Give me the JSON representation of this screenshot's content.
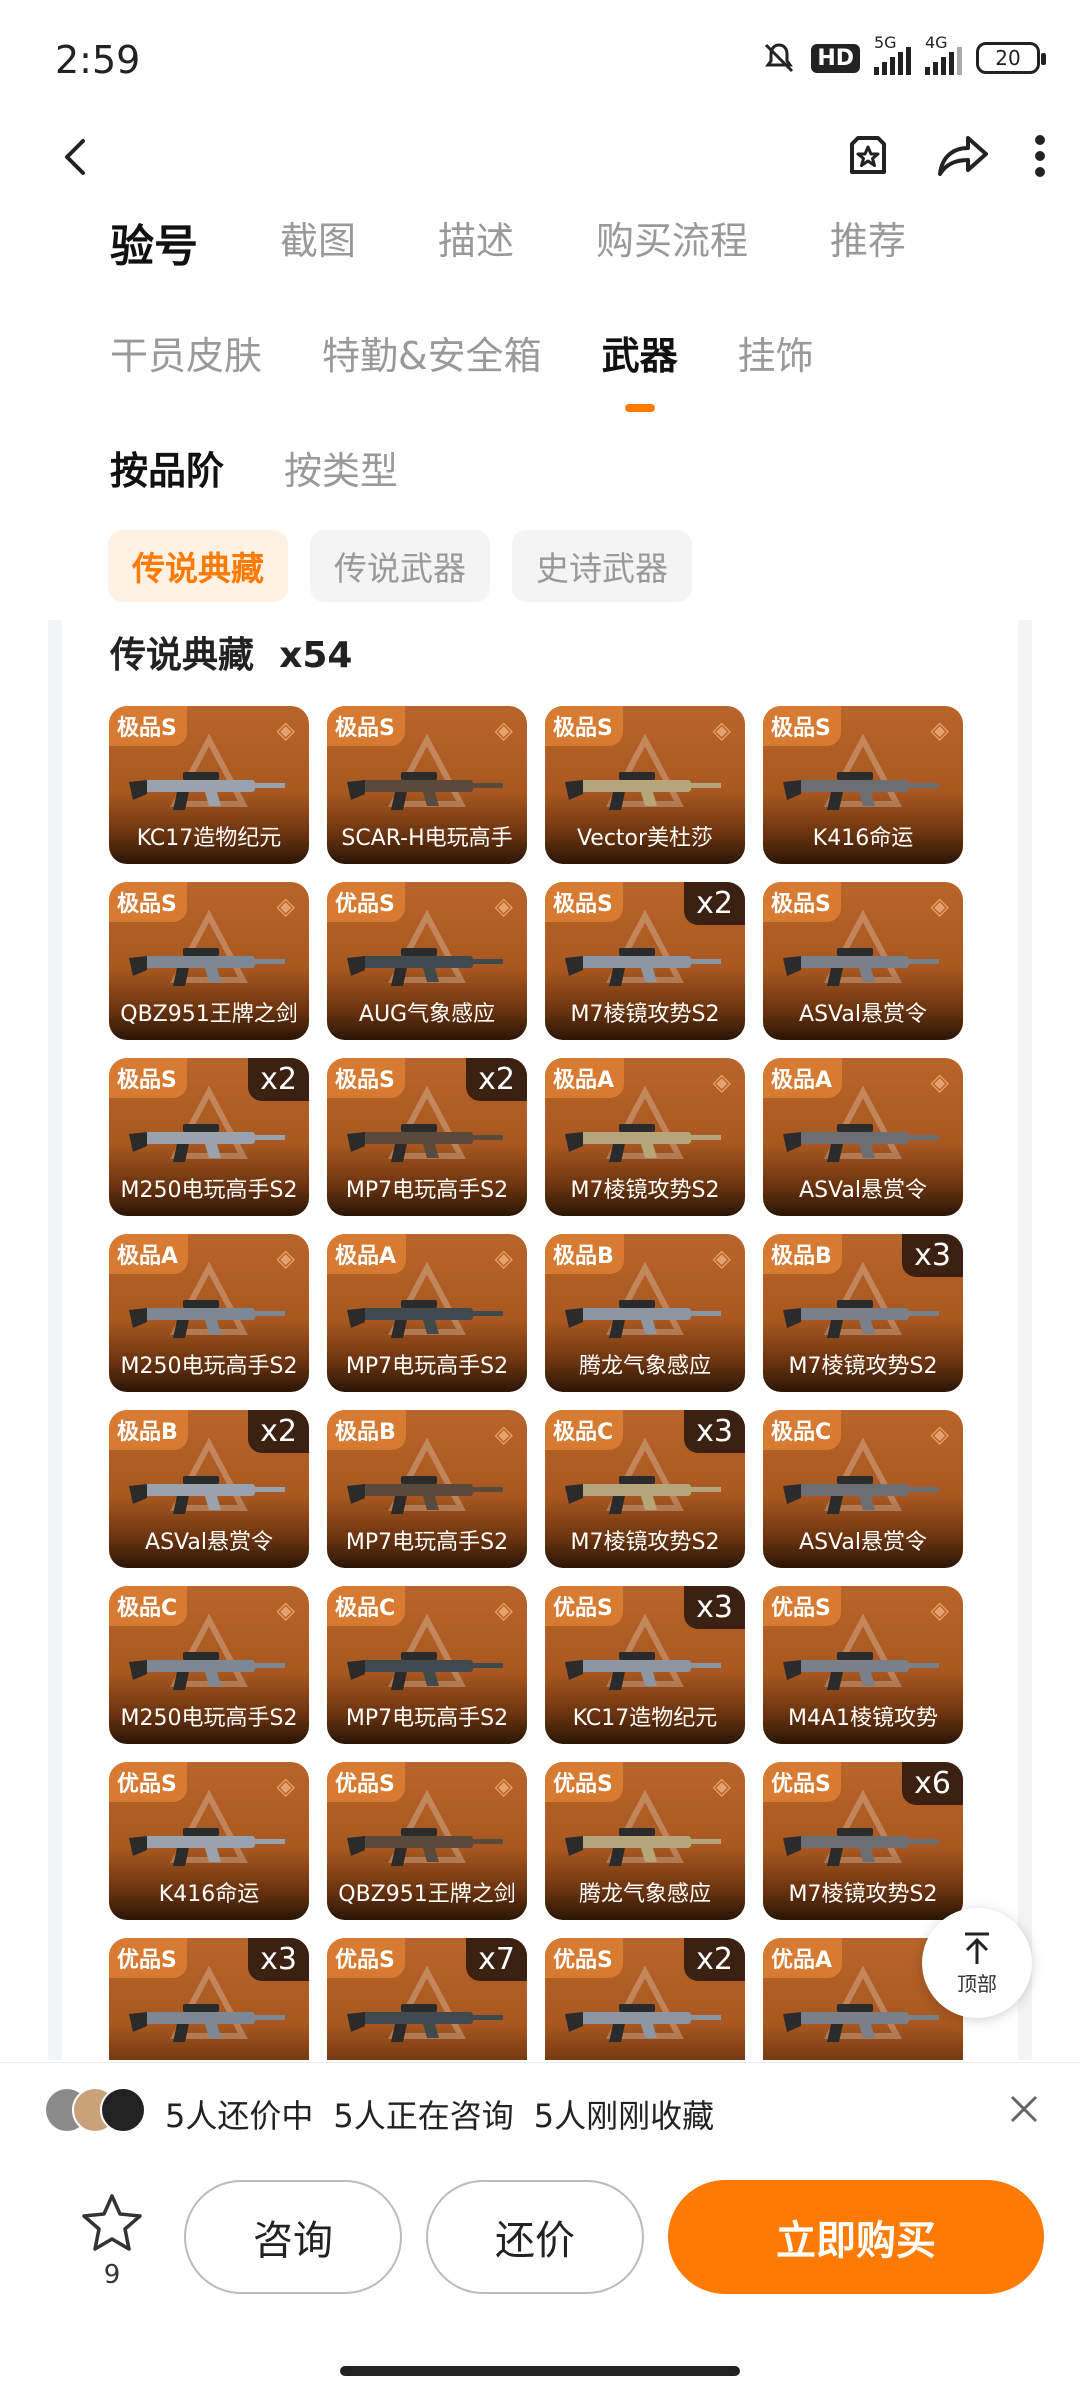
{
  "status_bar": {
    "time": "2:59",
    "hd": "HD",
    "net1": "5G",
    "net2": "4G",
    "battery": "20"
  },
  "tabs_main": [
    {
      "label": "验号",
      "active": true
    },
    {
      "label": "截图",
      "active": false
    },
    {
      "label": "描述",
      "active": false
    },
    {
      "label": "购买流程",
      "active": false
    },
    {
      "label": "推荐",
      "active": false
    }
  ],
  "tabs_category": [
    {
      "label": "干员皮肤",
      "active": false
    },
    {
      "label": "特勤&安全箱",
      "active": false
    },
    {
      "label": "武器",
      "active": true
    },
    {
      "label": "挂饰",
      "active": false
    }
  ],
  "tabs_sort": [
    {
      "label": "按品阶",
      "active": true
    },
    {
      "label": "按类型",
      "active": false
    }
  ],
  "chips": [
    {
      "label": "传说典藏",
      "active": true
    },
    {
      "label": "传说武器",
      "active": false
    },
    {
      "label": "史诗武器",
      "active": false
    }
  ],
  "section": {
    "title": "传说典藏",
    "count": "x54"
  },
  "items": [
    {
      "tier": "极品S",
      "name": "KC17造物纪元",
      "count": ""
    },
    {
      "tier": "极品S",
      "name": "SCAR-H电玩高手",
      "count": ""
    },
    {
      "tier": "极品S",
      "name": "Vector美杜莎",
      "count": ""
    },
    {
      "tier": "极品S",
      "name": "K416命运",
      "count": ""
    },
    {
      "tier": "极品S",
      "name": "QBZ951王牌之剑",
      "count": ""
    },
    {
      "tier": "优品S",
      "name": "AUG气象感应",
      "count": ""
    },
    {
      "tier": "极品S",
      "name": "M7棱镜攻势S2",
      "count": "x2"
    },
    {
      "tier": "极品S",
      "name": "ASVal悬赏令",
      "count": ""
    },
    {
      "tier": "极品S",
      "name": "M250电玩高手S2",
      "count": "x2"
    },
    {
      "tier": "极品S",
      "name": "MP7电玩高手S2",
      "count": "x2"
    },
    {
      "tier": "极品A",
      "name": "M7棱镜攻势S2",
      "count": ""
    },
    {
      "tier": "极品A",
      "name": "ASVal悬赏令",
      "count": ""
    },
    {
      "tier": "极品A",
      "name": "M250电玩高手S2",
      "count": ""
    },
    {
      "tier": "极品A",
      "name": "MP7电玩高手S2",
      "count": ""
    },
    {
      "tier": "极品B",
      "name": "腾龙气象感应",
      "count": ""
    },
    {
      "tier": "极品B",
      "name": "M7棱镜攻势S2",
      "count": "x3"
    },
    {
      "tier": "极品B",
      "name": "ASVal悬赏令",
      "count": "x2"
    },
    {
      "tier": "极品B",
      "name": "MP7电玩高手S2",
      "count": ""
    },
    {
      "tier": "极品C",
      "name": "M7棱镜攻势S2",
      "count": "x3"
    },
    {
      "tier": "极品C",
      "name": "ASVal悬赏令",
      "count": ""
    },
    {
      "tier": "极品C",
      "name": "M250电玩高手S2",
      "count": ""
    },
    {
      "tier": "极品C",
      "name": "MP7电玩高手S2",
      "count": ""
    },
    {
      "tier": "优品S",
      "name": "KC17造物纪元",
      "count": "x3"
    },
    {
      "tier": "优品S",
      "name": "M4A1棱镜攻势",
      "count": ""
    },
    {
      "tier": "优品S",
      "name": "K416命运",
      "count": ""
    },
    {
      "tier": "优品S",
      "name": "QBZ951王牌之剑",
      "count": ""
    },
    {
      "tier": "优品S",
      "name": "腾龙气象感应",
      "count": ""
    },
    {
      "tier": "优品S",
      "name": "M7棱镜攻势S2",
      "count": "x6"
    },
    {
      "tier": "优品S",
      "name": "",
      "count": "x3"
    },
    {
      "tier": "优品S",
      "name": "",
      "count": "x7"
    },
    {
      "tier": "优品S",
      "name": "",
      "count": "x2"
    },
    {
      "tier": "优品A",
      "name": "",
      "count": ""
    }
  ],
  "back_to_top": "顶部",
  "ticker": {
    "bargaining": "5人还价中",
    "consulting": "5人正在咨询",
    "favorited": "5人刚刚收藏"
  },
  "bottom_bar": {
    "fav_count": "9",
    "consult": "咨询",
    "bargain": "还价",
    "buy": "立即购买"
  },
  "colors": {
    "accent": "#ff7a00",
    "card_top": "#b8652c",
    "card_bottom": "#2a1506"
  }
}
